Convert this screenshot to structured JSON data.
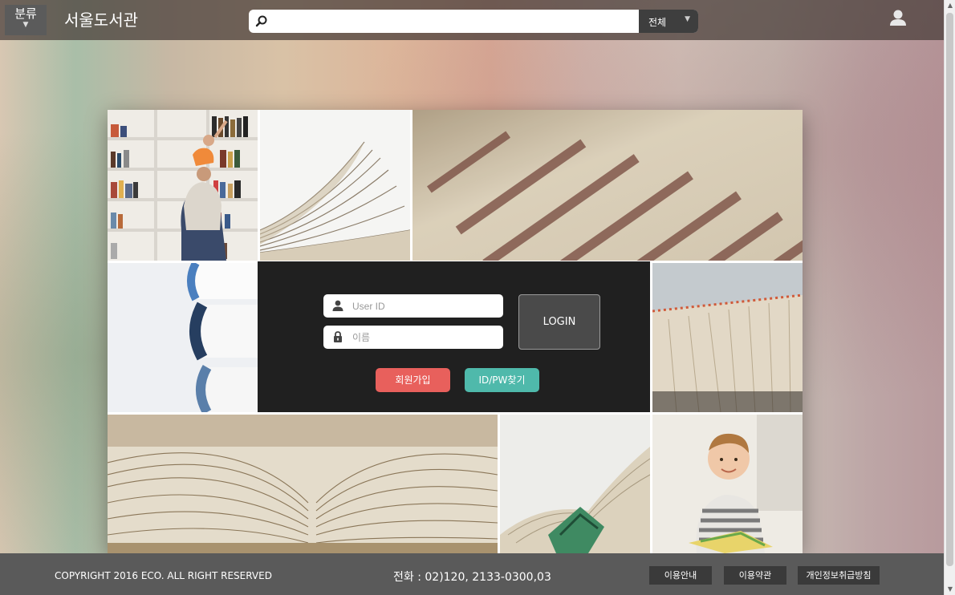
{
  "header": {
    "category_label": "분류",
    "category_arrow": "▼",
    "site_title": "서울도서관",
    "search": {
      "value": "",
      "placeholder": ""
    },
    "scope": {
      "selected": "전체",
      "arrow": "▼"
    },
    "user_icon": "user-icon"
  },
  "login": {
    "user_id_placeholder": "User ID",
    "name_placeholder": "이름",
    "login_label": "LOGIN",
    "join_label": "회원가입",
    "find_label": "ID/PW찾기"
  },
  "footer": {
    "copyright": "COPYRIGHT 2016 ECO. ALL RIGHT RESERVED",
    "phone": "전화 : 02)120, 2133-0300,03",
    "links": [
      "이용안내",
      "이용약관",
      "개인정보취급방침"
    ]
  },
  "colors": {
    "join_button": "#e8605c",
    "find_button": "#4fb9ab",
    "login_panel": "#202020",
    "footer": "#5a5a5a"
  },
  "icons": [
    "search-icon",
    "user-icon",
    "person-icon",
    "lock-icon"
  ],
  "scrollbar": {
    "up": "▲",
    "down": "▼"
  }
}
